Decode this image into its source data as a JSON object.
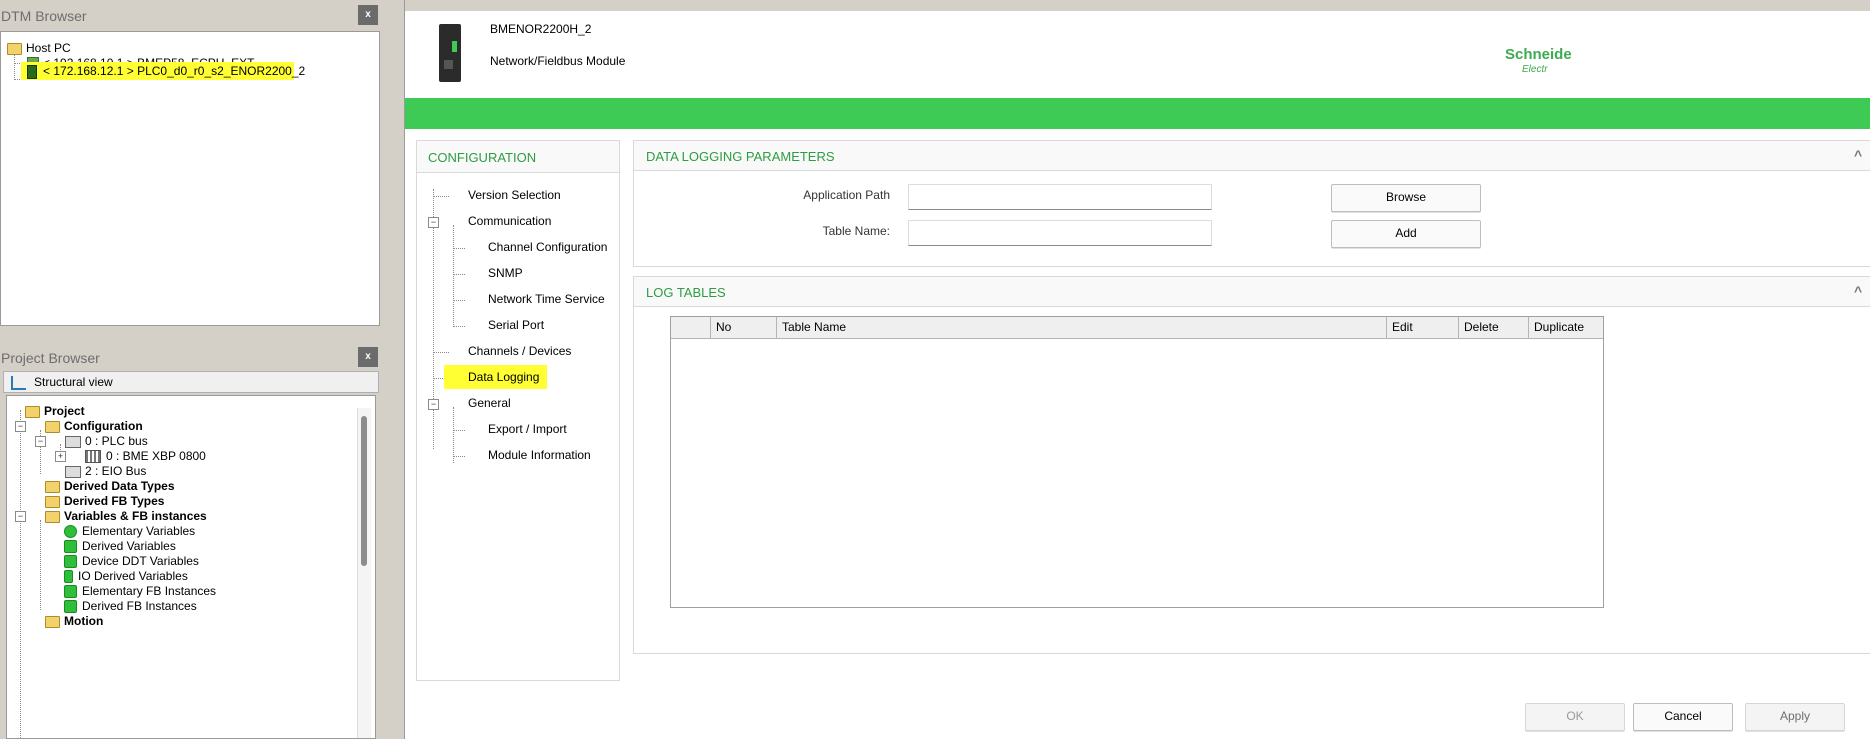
{
  "dtm_browser": {
    "title": "DTM Browser",
    "close": "x",
    "items": [
      {
        "label": "Host PC"
      },
      {
        "label": "< 192.168.10.1 > BMEP58_ECPU_EXT"
      },
      {
        "label": "< 172.168.12.1 > PLC0_d0_r0_s2_ENOR2200_2"
      }
    ]
  },
  "project_browser": {
    "title": "Project Browser",
    "close": "x",
    "view_label": "Structural view",
    "tree": {
      "project": "Project",
      "configuration": "Configuration",
      "plc_bus": "0 : PLC bus",
      "xbp": "0 : BME XBP 0800",
      "eio_bus": "2 : EIO Bus",
      "derived_data_types": "Derived Data Types",
      "derived_fb_types": "Derived FB Types",
      "vars_fb": "Variables & FB instances",
      "elementary_vars": "Elementary Variables",
      "derived_vars": "Derived Variables",
      "device_ddt_vars": "Device DDT Variables",
      "io_derived_vars": "IO Derived Variables",
      "elementary_fb": "Elementary FB Instances",
      "derived_fb": "Derived FB Instances",
      "motion": "Motion"
    }
  },
  "module": {
    "name": "BMENOR2200H_2",
    "type": "Network/Fieldbus Module",
    "brand_line1": "Schneide",
    "brand_line2": "Electr",
    "accent_color": "#3dcb56"
  },
  "config_nav": {
    "header": "CONFIGURATION",
    "items": {
      "version_selection": "Version Selection",
      "communication": "Communication",
      "channel_configuration": "Channel Configuration",
      "snmp": "SNMP",
      "network_time_service": "Network Time Service",
      "serial_port": "Serial Port",
      "channels_devices": "Channels / Devices",
      "data_logging": "Data Logging",
      "general": "General",
      "export_import": "Export / Import",
      "module_information": "Module Information"
    }
  },
  "data_logging_params": {
    "header": "DATA LOGGING PARAMETERS",
    "application_path_label": "Application Path",
    "application_path_value": "",
    "table_name_label": "Table Name:",
    "table_name_value": "",
    "browse_label": "Browse",
    "add_label": "Add"
  },
  "log_tables": {
    "header": "LOG TABLES",
    "columns": [
      "",
      "No",
      "Table Name",
      "Edit",
      "Delete",
      "Duplicate"
    ],
    "rows": []
  },
  "footer": {
    "ok": "OK",
    "cancel": "Cancel",
    "apply": "Apply"
  },
  "collapse_glyph": "^"
}
